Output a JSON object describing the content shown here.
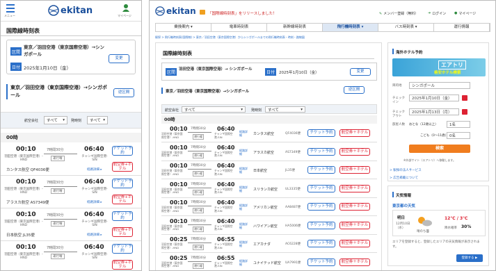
{
  "brand": "ekitan",
  "mobile": {
    "menu_label": "メニュー",
    "mypage_label": "マイページ",
    "page_title": "国際線時刻表",
    "dep_tag": "区間",
    "route": "東京／羽田空港（東京国際空港）→シンガポール",
    "change_btn": "変更",
    "date_tag": "日付",
    "date": "2025年1月10日（金）",
    "route_title": "東京／羽田空港（東京国際空港）→シンガポール",
    "reverse_btn": "逆区間",
    "airline_label": "航空会社",
    "airline_value": "すべて",
    "time_label": "発時刻",
    "time_value": "すべて",
    "hour": "00時",
    "flights": [
      {
        "dep": "00:10",
        "dur": "7時間30分",
        "arr": "06:40",
        "from": "羽田空港（東京国際空港）-HND",
        "to": "チャンギ国際空港-SIN",
        "ops": "運行曜",
        "ticket": "チケット予約",
        "airline": "カンタス航空 QF4036便",
        "detail": "経路詳細 ▸",
        "hotel": "航空券+ホテル"
      },
      {
        "dep": "00:10",
        "dur": "7時間30分",
        "arr": "06:40",
        "from": "羽田空港（東京国際空港）-HND",
        "to": "チャンギ国際空港-SIN",
        "ops": "運行曜",
        "ticket": "チケット予約",
        "airline": "アラスカ航空 AS7349便",
        "detail": "経路詳細 ▸",
        "hotel": "航空券+ホテル"
      },
      {
        "dep": "00:10",
        "dur": "7時間30分",
        "arr": "06:40",
        "from": "羽田空港（東京国際空港）-HND",
        "to": "チャンギ国際空港-SIN",
        "ops": "運行曜",
        "ticket": "チケット予約",
        "airline": "日本航空 JL35便",
        "detail": "経路詳細 ▸",
        "hotel": "航空券+ホテル"
      },
      {
        "dep": "00:10",
        "dur": "7時間30分",
        "arr": "06:40",
        "from": "羽田空港（東京国際空港）-HND",
        "to": "チャンギ国際空港-SIN",
        "ops": "運行曜",
        "ticket": "チケット予約",
        "airline": "",
        "detail": "",
        "hotel": "航空券+ホテル"
      }
    ]
  },
  "desktop": {
    "promo": "「国際線時刻表」をリリースしました！",
    "member": "メンバー登録（無料）",
    "login": "ログイン",
    "mypage": "マイページ",
    "nav": [
      "乗換案内 ▾",
      "電車時刻表",
      "新幹線時刻表",
      "飛行機時刻表 ▾",
      "バス時刻表 ▾",
      "運行情報"
    ],
    "breadcrumb": "駅探 > 飛行機時刻表(国際線) > 東京／羽田空港（東京国際空港）からシンガポールまでの飛行機時刻表・時刻・路線図",
    "page_title": "国際線時刻表",
    "dep_tag": "区間",
    "route": "羽田空港（東京国際空港）→ シンガポール",
    "date_tag": "日付",
    "date": "2025年1月10日（金）",
    "change_btn": "変更",
    "route_title": "東京／羽田空港（東京国際空港）→シンガポール",
    "reverse_btn": "逆区間",
    "airline_label": "航空会社",
    "airline_value": "すべて",
    "time_label": "発時刻",
    "time_value": "すべて",
    "hour": "00時",
    "rows": [
      {
        "dep": "00:10",
        "dur": "7時間30分",
        "arr": "06:40",
        "from": "羽田空港（東京国際空港）-HND",
        "to": "チャンギ国際空港-SIN",
        "ops": "運行曜",
        "detail": "経路詳細",
        "airline": "カンタス航空",
        "flight": "QF4036便",
        "ticket": "チケット予約",
        "hotel": "航空券＋ホテル"
      },
      {
        "dep": "00:10",
        "dur": "7時間30分",
        "arr": "06:40",
        "from": "羽田空港（東京国際空港）-HND",
        "to": "チャンギ国際空港-SIN",
        "ops": "運行曜",
        "detail": "経路詳細",
        "airline": "アラスカ航空",
        "flight": "AS7349便",
        "ticket": "チケット予約",
        "hotel": "航空券＋ホテル"
      },
      {
        "dep": "00:10",
        "dur": "7時間30分",
        "arr": "06:40",
        "from": "羽田空港（東京国際空港）-HND",
        "to": "チャンギ国際空港-SIN",
        "ops": "運行曜",
        "detail": "経路詳細",
        "airline": "日本航空",
        "flight": "JL35便",
        "ticket": "チケット予約",
        "hotel": "航空券＋ホテル"
      },
      {
        "dep": "00:10",
        "dur": "7時間30分",
        "arr": "06:40",
        "from": "羽田空港（東京国際空港）-HND",
        "to": "チャンギ国際空港-SIN",
        "ops": "運行曜",
        "detail": "経路詳細",
        "airline": "スリランカ航空",
        "flight": "UL3335便",
        "ticket": "チケット予約",
        "hotel": "航空券＋ホテル"
      },
      {
        "dep": "00:10",
        "dur": "7時間30分",
        "arr": "06:40",
        "from": "羽田空港（東京国際空港）-HND",
        "to": "チャンギ国際空港-SIN",
        "ops": "運行曜",
        "detail": "経路詳細",
        "airline": "アメリカン航空",
        "flight": "AA8487便",
        "ticket": "チケット予約",
        "hotel": "航空券＋ホテル"
      },
      {
        "dep": "00:10",
        "dur": "7時間30分",
        "arr": "06:40",
        "from": "羽田空港（東京国際空港）-HND",
        "to": "チャンギ国際空港-SIN",
        "ops": "運行曜",
        "detail": "経路詳細",
        "airline": "ハワイアン航空",
        "flight": "HA5006便",
        "ticket": "チケット予約",
        "hotel": "航空券＋ホテル"
      },
      {
        "dep": "00:25",
        "dur": "7時間30分",
        "arr": "06:55",
        "from": "羽田空港（東京国際空港）-HND",
        "to": "チャンギ国際空港-SIN",
        "ops": "運行曜",
        "detail": "経路詳細",
        "airline": "エアカナダ",
        "flight": "AC6228便",
        "ticket": "チケット予約",
        "hotel": "航空券＋ホテル"
      },
      {
        "dep": "00:25",
        "dur": "7時間30分",
        "arr": "06:55",
        "from": "羽田空港（東京国際空港）-HND",
        "to": "チャンギ国際空港-SIN",
        "ops": "運行曜",
        "detail": "経路詳細",
        "airline": "ユナイテッド航空",
        "flight": "UA7991便",
        "ticket": "チケット予約",
        "hotel": "航空券＋ホテル"
      }
    ],
    "hotel_box": {
      "title": "海外ホテル予約",
      "banner_brand": "エアトリ",
      "banner_sub": "格安ホテル検索",
      "dest_label": "目的地",
      "dest_value": "シンガポール",
      "checkin_label": "チェックイン",
      "checkin_value": "2025年1月10日（金）",
      "checkout_label": "チェックアウト",
      "checkout_value": "2025年1月13日（月）",
      "adult_label": "部屋人数",
      "adult_value": "おとな（12歳以上）",
      "adult_count": "1名",
      "child_label": "こども（0〜11歳）",
      "child_count": "0名",
      "search_btn": "検索",
      "note": "※外部サイト（エアトリ）へ移動します。",
      "link1": "> 駅探の法人サービス",
      "link2": "> 広告掲載について"
    },
    "weather": {
      "title": "天気情報",
      "city": "東京都の天気",
      "day": "明日",
      "date": "12月10日（水）",
      "desc": "晴のち曇",
      "temp": "12℃ / 3℃",
      "rain_label": "降水確率",
      "rain": "30%",
      "note": "エリアを登録すると、登録したエリアの天気情報が表示されます。",
      "register_btn": "登録する ▶"
    }
  }
}
